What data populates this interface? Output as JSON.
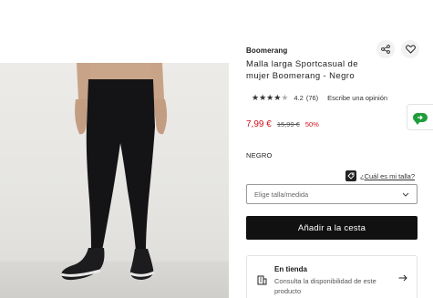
{
  "product": {
    "brand": "Boomerang",
    "title": "Malla larga Sportcasual de mujer Boomerang - Negro",
    "rating": {
      "stars_filled": 4,
      "stars_total": 5,
      "score": "4.2",
      "count": "(76)",
      "write_review": "Escribe una opinión"
    },
    "price": {
      "current": "7,99 €",
      "original": "15,99 €",
      "discount": "50%"
    },
    "color": "NEGRO",
    "size_guide": "¿Cuál es mi talla?",
    "size_select": {
      "placeholder": "Elige talla/medida"
    },
    "add_to_cart": "Añadir a la cesta",
    "store": {
      "title": "En tienda",
      "description": "Consulta la disponibilidad de este producto"
    }
  },
  "icons": {
    "share": "share-icon",
    "favorite": "heart-icon",
    "chat": "chat-icon",
    "size_tag": "tag-icon",
    "dropdown": "chevron-down-icon",
    "store": "building-icon",
    "arrow": "arrow-right-icon"
  },
  "colors": {
    "price_red": "#d2121f",
    "button_black": "#111111",
    "chat_green": "#1f9d3a"
  }
}
